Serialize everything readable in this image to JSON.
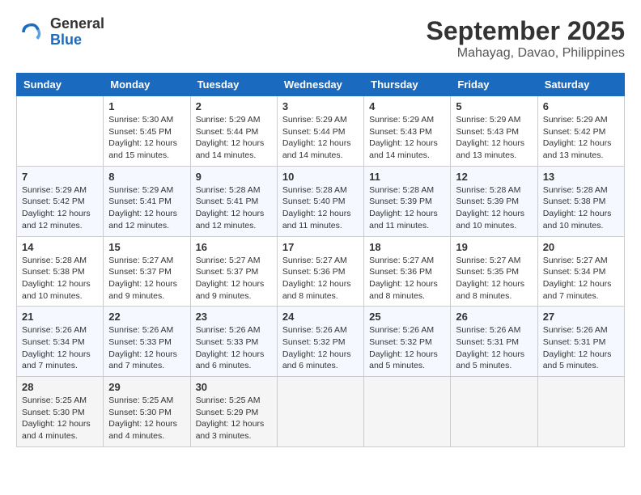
{
  "header": {
    "logo_general": "General",
    "logo_blue": "Blue",
    "month_title": "September 2025",
    "location": "Mahayag, Davao, Philippines"
  },
  "weekdays": [
    "Sunday",
    "Monday",
    "Tuesday",
    "Wednesday",
    "Thursday",
    "Friday",
    "Saturday"
  ],
  "weeks": [
    [
      {
        "day": "",
        "info": ""
      },
      {
        "day": "1",
        "info": "Sunrise: 5:30 AM\nSunset: 5:45 PM\nDaylight: 12 hours\nand 15 minutes."
      },
      {
        "day": "2",
        "info": "Sunrise: 5:29 AM\nSunset: 5:44 PM\nDaylight: 12 hours\nand 14 minutes."
      },
      {
        "day": "3",
        "info": "Sunrise: 5:29 AM\nSunset: 5:44 PM\nDaylight: 12 hours\nand 14 minutes."
      },
      {
        "day": "4",
        "info": "Sunrise: 5:29 AM\nSunset: 5:43 PM\nDaylight: 12 hours\nand 14 minutes."
      },
      {
        "day": "5",
        "info": "Sunrise: 5:29 AM\nSunset: 5:43 PM\nDaylight: 12 hours\nand 13 minutes."
      },
      {
        "day": "6",
        "info": "Sunrise: 5:29 AM\nSunset: 5:42 PM\nDaylight: 12 hours\nand 13 minutes."
      }
    ],
    [
      {
        "day": "7",
        "info": "Sunrise: 5:29 AM\nSunset: 5:42 PM\nDaylight: 12 hours\nand 12 minutes."
      },
      {
        "day": "8",
        "info": "Sunrise: 5:29 AM\nSunset: 5:41 PM\nDaylight: 12 hours\nand 12 minutes."
      },
      {
        "day": "9",
        "info": "Sunrise: 5:28 AM\nSunset: 5:41 PM\nDaylight: 12 hours\nand 12 minutes."
      },
      {
        "day": "10",
        "info": "Sunrise: 5:28 AM\nSunset: 5:40 PM\nDaylight: 12 hours\nand 11 minutes."
      },
      {
        "day": "11",
        "info": "Sunrise: 5:28 AM\nSunset: 5:39 PM\nDaylight: 12 hours\nand 11 minutes."
      },
      {
        "day": "12",
        "info": "Sunrise: 5:28 AM\nSunset: 5:39 PM\nDaylight: 12 hours\nand 10 minutes."
      },
      {
        "day": "13",
        "info": "Sunrise: 5:28 AM\nSunset: 5:38 PM\nDaylight: 12 hours\nand 10 minutes."
      }
    ],
    [
      {
        "day": "14",
        "info": "Sunrise: 5:28 AM\nSunset: 5:38 PM\nDaylight: 12 hours\nand 10 minutes."
      },
      {
        "day": "15",
        "info": "Sunrise: 5:27 AM\nSunset: 5:37 PM\nDaylight: 12 hours\nand 9 minutes."
      },
      {
        "day": "16",
        "info": "Sunrise: 5:27 AM\nSunset: 5:37 PM\nDaylight: 12 hours\nand 9 minutes."
      },
      {
        "day": "17",
        "info": "Sunrise: 5:27 AM\nSunset: 5:36 PM\nDaylight: 12 hours\nand 8 minutes."
      },
      {
        "day": "18",
        "info": "Sunrise: 5:27 AM\nSunset: 5:36 PM\nDaylight: 12 hours\nand 8 minutes."
      },
      {
        "day": "19",
        "info": "Sunrise: 5:27 AM\nSunset: 5:35 PM\nDaylight: 12 hours\nand 8 minutes."
      },
      {
        "day": "20",
        "info": "Sunrise: 5:27 AM\nSunset: 5:34 PM\nDaylight: 12 hours\nand 7 minutes."
      }
    ],
    [
      {
        "day": "21",
        "info": "Sunrise: 5:26 AM\nSunset: 5:34 PM\nDaylight: 12 hours\nand 7 minutes."
      },
      {
        "day": "22",
        "info": "Sunrise: 5:26 AM\nSunset: 5:33 PM\nDaylight: 12 hours\nand 7 minutes."
      },
      {
        "day": "23",
        "info": "Sunrise: 5:26 AM\nSunset: 5:33 PM\nDaylight: 12 hours\nand 6 minutes."
      },
      {
        "day": "24",
        "info": "Sunrise: 5:26 AM\nSunset: 5:32 PM\nDaylight: 12 hours\nand 6 minutes."
      },
      {
        "day": "25",
        "info": "Sunrise: 5:26 AM\nSunset: 5:32 PM\nDaylight: 12 hours\nand 5 minutes."
      },
      {
        "day": "26",
        "info": "Sunrise: 5:26 AM\nSunset: 5:31 PM\nDaylight: 12 hours\nand 5 minutes."
      },
      {
        "day": "27",
        "info": "Sunrise: 5:26 AM\nSunset: 5:31 PM\nDaylight: 12 hours\nand 5 minutes."
      }
    ],
    [
      {
        "day": "28",
        "info": "Sunrise: 5:25 AM\nSunset: 5:30 PM\nDaylight: 12 hours\nand 4 minutes."
      },
      {
        "day": "29",
        "info": "Sunrise: 5:25 AM\nSunset: 5:30 PM\nDaylight: 12 hours\nand 4 minutes."
      },
      {
        "day": "30",
        "info": "Sunrise: 5:25 AM\nSunset: 5:29 PM\nDaylight: 12 hours\nand 3 minutes."
      },
      {
        "day": "",
        "info": ""
      },
      {
        "day": "",
        "info": ""
      },
      {
        "day": "",
        "info": ""
      },
      {
        "day": "",
        "info": ""
      }
    ]
  ]
}
